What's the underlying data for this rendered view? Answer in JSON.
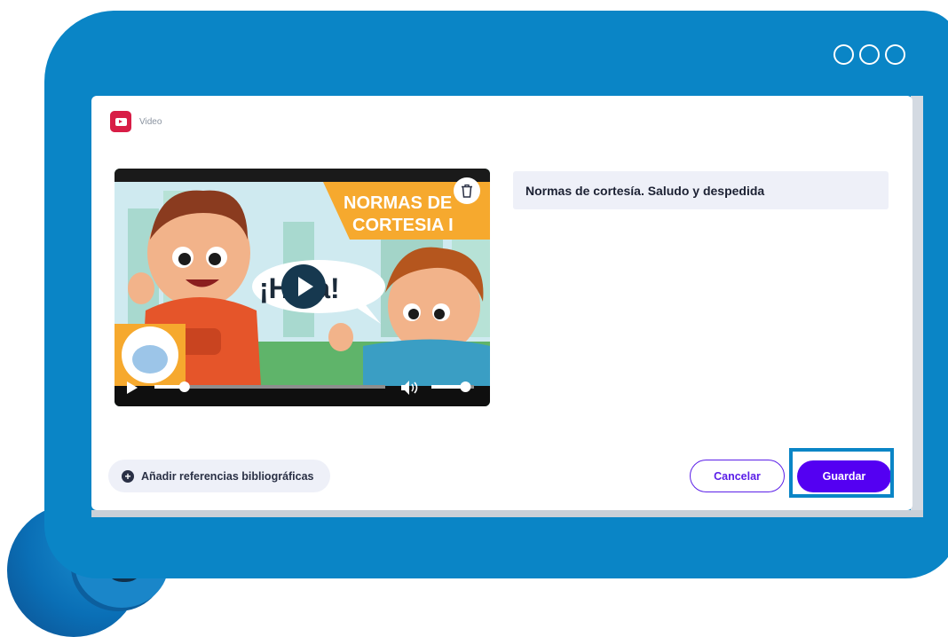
{
  "header": {
    "label": "Video",
    "icon": "youtube-icon"
  },
  "video": {
    "thumbnail_title_lines": [
      "NORMAS DE",
      "CORTESIA I"
    ],
    "speech_bubble": "¡Hola!",
    "play_icon": "play-icon",
    "delete_icon": "trash-icon",
    "progress": 0.13,
    "volume": 0.8
  },
  "title_field": {
    "value": "Normas de cortesía. Saludo y despedida"
  },
  "actions": {
    "add_references_label": "Añadir referencias bibliográficas",
    "cancel_label": "Cancelar",
    "save_label": "Guardar"
  },
  "colors": {
    "frame": "#0a85c6",
    "primary": "#5400f2",
    "youtube": "#d81d46",
    "field_bg": "#eef0f8"
  }
}
